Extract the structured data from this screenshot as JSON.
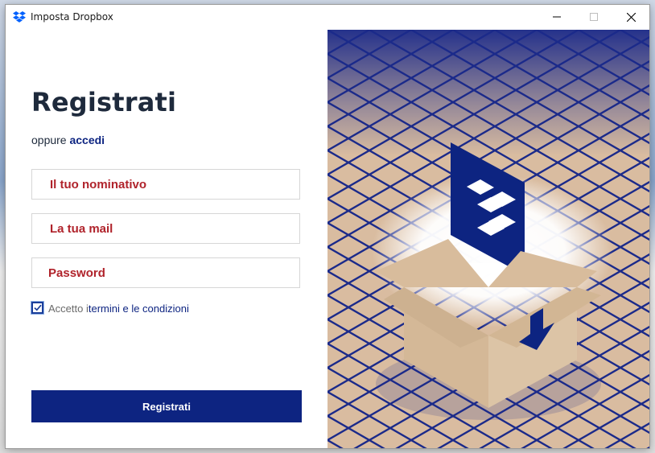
{
  "window": {
    "title": "Imposta Dropbox",
    "controls": {
      "minimize_icon": "minimize-icon",
      "maximize_icon": "maximize-icon",
      "close_icon": "close-icon"
    }
  },
  "form": {
    "heading": "Registrati",
    "alt_prefix": "oppure ",
    "alt_link": "accedi",
    "fields": {
      "name_placeholder": "Il tuo nominativo",
      "email_placeholder": "La tua mail",
      "password_placeholder": "Password"
    },
    "terms": {
      "checked": true,
      "prefix": "Accetto i ",
      "link": "termini e le condizioni"
    },
    "submit_label": "Registrati"
  },
  "colors": {
    "brand_blue": "#0d2481",
    "placeholder_red": "#b0232b",
    "heading": "#1e2a3c",
    "illustration_bg": "#d9bca0"
  },
  "illustration": {
    "subject": "open cardboard box with Dropbox logo and download arrow on isometric grid"
  }
}
